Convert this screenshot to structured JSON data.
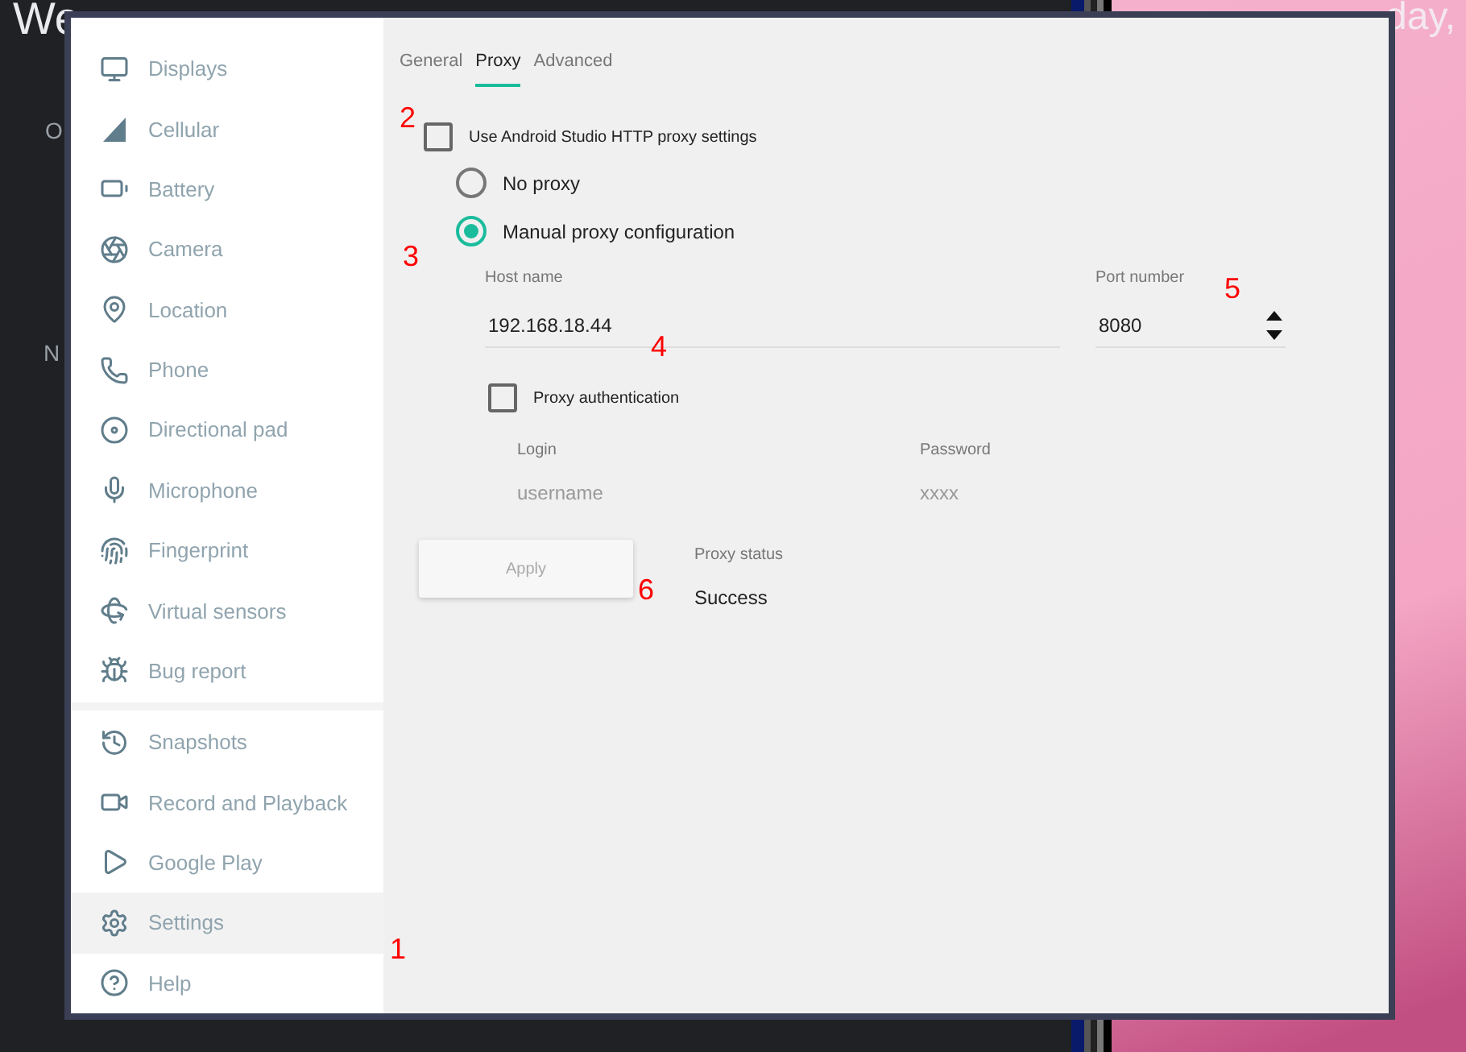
{
  "background": {
    "left_texts": [
      "We",
      "O",
      "N"
    ],
    "right_text": "day,"
  },
  "sidebar": {
    "items": [
      {
        "label": "Displays",
        "selected": false
      },
      {
        "label": "Cellular",
        "selected": false
      },
      {
        "label": "Battery",
        "selected": false
      },
      {
        "label": "Camera",
        "selected": false
      },
      {
        "label": "Location",
        "selected": false
      },
      {
        "label": "Phone",
        "selected": false
      },
      {
        "label": "Directional pad",
        "selected": false
      },
      {
        "label": "Microphone",
        "selected": false
      },
      {
        "label": "Fingerprint",
        "selected": false
      },
      {
        "label": "Virtual sensors",
        "selected": false
      },
      {
        "label": "Bug report",
        "selected": false
      }
    ],
    "bottom_items": [
      {
        "label": "Snapshots",
        "selected": false
      },
      {
        "label": "Record and Playback",
        "selected": false
      },
      {
        "label": "Google Play",
        "selected": false
      },
      {
        "label": "Settings",
        "selected": true
      },
      {
        "label": "Help",
        "selected": false
      }
    ]
  },
  "tabs": [
    {
      "label": "General",
      "selected": false
    },
    {
      "label": "Proxy",
      "selected": true
    },
    {
      "label": "Advanced",
      "selected": false
    }
  ],
  "studio_proxy": {
    "label": "Use Android Studio HTTP proxy settings",
    "checked": false
  },
  "proxy_modes": [
    {
      "label": "No proxy",
      "selected": false
    },
    {
      "label": "Manual proxy configuration",
      "selected": true
    }
  ],
  "host": {
    "label": "Host name",
    "value": "192.168.18.44"
  },
  "port": {
    "label": "Port number",
    "value": "8080"
  },
  "auth": {
    "label": "Proxy authentication",
    "checked": false
  },
  "login": {
    "label": "Login",
    "placeholder": "username"
  },
  "password": {
    "label": "Password",
    "placeholder": "xxxx"
  },
  "apply": {
    "label": "Apply",
    "disabled": true
  },
  "status": {
    "label": "Proxy status",
    "value": "Success"
  },
  "annotations": [
    "1",
    "2",
    "3",
    "4",
    "5",
    "6"
  ]
}
